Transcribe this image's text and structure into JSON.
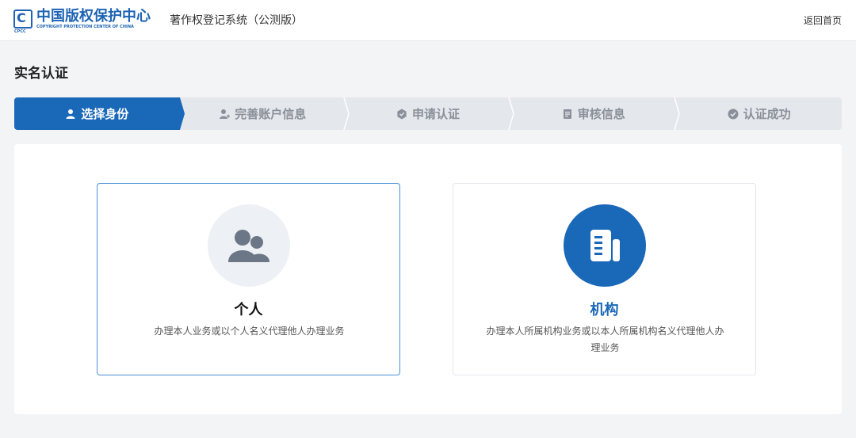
{
  "header": {
    "logo_cn": "中国版权保护中心",
    "logo_en": "COPYRIGHT PROTECTION CENTER OF CHINA",
    "logo_abbr": "CPCC",
    "logo_mark": "C",
    "system_name": "著作权登记系统（公测版）",
    "home_link": "返回首页"
  },
  "page": {
    "title": "实名认证"
  },
  "steps": [
    {
      "label": "选择身份",
      "icon": "user-icon",
      "active": true
    },
    {
      "label": "完善账户信息",
      "icon": "user-add-icon",
      "active": false
    },
    {
      "label": "申请认证",
      "icon": "badge-icon",
      "active": false
    },
    {
      "label": "审核信息",
      "icon": "document-icon",
      "active": false
    },
    {
      "label": "认证成功",
      "icon": "check-circle-icon",
      "active": false
    }
  ],
  "cards": {
    "personal": {
      "title": "个人",
      "desc": "办理本人业务或以个人名义代理他人办理业务",
      "icon": "people-icon"
    },
    "org": {
      "title": "机构",
      "desc": "办理本人所属机构业务或以本人所属机构名义代理他人办理业务",
      "icon": "building-document-icon"
    }
  },
  "colors": {
    "primary": "#1a68b8",
    "step_inactive": "#e4e7ec",
    "background": "#f3f4f6"
  }
}
